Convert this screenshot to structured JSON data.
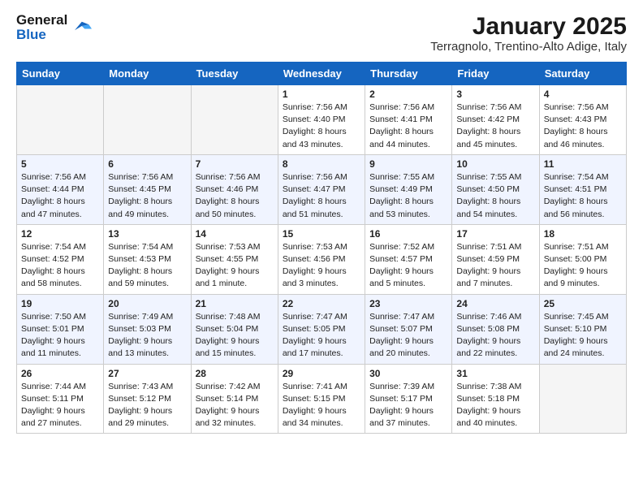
{
  "header": {
    "logo_line1": "General",
    "logo_line2": "Blue",
    "title": "January 2025",
    "subtitle": "Terragnolo, Trentino-Alto Adige, Italy"
  },
  "days_of_week": [
    "Sunday",
    "Monday",
    "Tuesday",
    "Wednesday",
    "Thursday",
    "Friday",
    "Saturday"
  ],
  "weeks": [
    [
      {
        "day": "",
        "info": ""
      },
      {
        "day": "",
        "info": ""
      },
      {
        "day": "",
        "info": ""
      },
      {
        "day": "1",
        "info": "Sunrise: 7:56 AM\nSunset: 4:40 PM\nDaylight: 8 hours and 43 minutes."
      },
      {
        "day": "2",
        "info": "Sunrise: 7:56 AM\nSunset: 4:41 PM\nDaylight: 8 hours and 44 minutes."
      },
      {
        "day": "3",
        "info": "Sunrise: 7:56 AM\nSunset: 4:42 PM\nDaylight: 8 hours and 45 minutes."
      },
      {
        "day": "4",
        "info": "Sunrise: 7:56 AM\nSunset: 4:43 PM\nDaylight: 8 hours and 46 minutes."
      }
    ],
    [
      {
        "day": "5",
        "info": "Sunrise: 7:56 AM\nSunset: 4:44 PM\nDaylight: 8 hours and 47 minutes."
      },
      {
        "day": "6",
        "info": "Sunrise: 7:56 AM\nSunset: 4:45 PM\nDaylight: 8 hours and 49 minutes."
      },
      {
        "day": "7",
        "info": "Sunrise: 7:56 AM\nSunset: 4:46 PM\nDaylight: 8 hours and 50 minutes."
      },
      {
        "day": "8",
        "info": "Sunrise: 7:56 AM\nSunset: 4:47 PM\nDaylight: 8 hours and 51 minutes."
      },
      {
        "day": "9",
        "info": "Sunrise: 7:55 AM\nSunset: 4:49 PM\nDaylight: 8 hours and 53 minutes."
      },
      {
        "day": "10",
        "info": "Sunrise: 7:55 AM\nSunset: 4:50 PM\nDaylight: 8 hours and 54 minutes."
      },
      {
        "day": "11",
        "info": "Sunrise: 7:54 AM\nSunset: 4:51 PM\nDaylight: 8 hours and 56 minutes."
      }
    ],
    [
      {
        "day": "12",
        "info": "Sunrise: 7:54 AM\nSunset: 4:52 PM\nDaylight: 8 hours and 58 minutes."
      },
      {
        "day": "13",
        "info": "Sunrise: 7:54 AM\nSunset: 4:53 PM\nDaylight: 8 hours and 59 minutes."
      },
      {
        "day": "14",
        "info": "Sunrise: 7:53 AM\nSunset: 4:55 PM\nDaylight: 9 hours and 1 minute."
      },
      {
        "day": "15",
        "info": "Sunrise: 7:53 AM\nSunset: 4:56 PM\nDaylight: 9 hours and 3 minutes."
      },
      {
        "day": "16",
        "info": "Sunrise: 7:52 AM\nSunset: 4:57 PM\nDaylight: 9 hours and 5 minutes."
      },
      {
        "day": "17",
        "info": "Sunrise: 7:51 AM\nSunset: 4:59 PM\nDaylight: 9 hours and 7 minutes."
      },
      {
        "day": "18",
        "info": "Sunrise: 7:51 AM\nSunset: 5:00 PM\nDaylight: 9 hours and 9 minutes."
      }
    ],
    [
      {
        "day": "19",
        "info": "Sunrise: 7:50 AM\nSunset: 5:01 PM\nDaylight: 9 hours and 11 minutes."
      },
      {
        "day": "20",
        "info": "Sunrise: 7:49 AM\nSunset: 5:03 PM\nDaylight: 9 hours and 13 minutes."
      },
      {
        "day": "21",
        "info": "Sunrise: 7:48 AM\nSunset: 5:04 PM\nDaylight: 9 hours and 15 minutes."
      },
      {
        "day": "22",
        "info": "Sunrise: 7:47 AM\nSunset: 5:05 PM\nDaylight: 9 hours and 17 minutes."
      },
      {
        "day": "23",
        "info": "Sunrise: 7:47 AM\nSunset: 5:07 PM\nDaylight: 9 hours and 20 minutes."
      },
      {
        "day": "24",
        "info": "Sunrise: 7:46 AM\nSunset: 5:08 PM\nDaylight: 9 hours and 22 minutes."
      },
      {
        "day": "25",
        "info": "Sunrise: 7:45 AM\nSunset: 5:10 PM\nDaylight: 9 hours and 24 minutes."
      }
    ],
    [
      {
        "day": "26",
        "info": "Sunrise: 7:44 AM\nSunset: 5:11 PM\nDaylight: 9 hours and 27 minutes."
      },
      {
        "day": "27",
        "info": "Sunrise: 7:43 AM\nSunset: 5:12 PM\nDaylight: 9 hours and 29 minutes."
      },
      {
        "day": "28",
        "info": "Sunrise: 7:42 AM\nSunset: 5:14 PM\nDaylight: 9 hours and 32 minutes."
      },
      {
        "day": "29",
        "info": "Sunrise: 7:41 AM\nSunset: 5:15 PM\nDaylight: 9 hours and 34 minutes."
      },
      {
        "day": "30",
        "info": "Sunrise: 7:39 AM\nSunset: 5:17 PM\nDaylight: 9 hours and 37 minutes."
      },
      {
        "day": "31",
        "info": "Sunrise: 7:38 AM\nSunset: 5:18 PM\nDaylight: 9 hours and 40 minutes."
      },
      {
        "day": "",
        "info": ""
      }
    ]
  ]
}
